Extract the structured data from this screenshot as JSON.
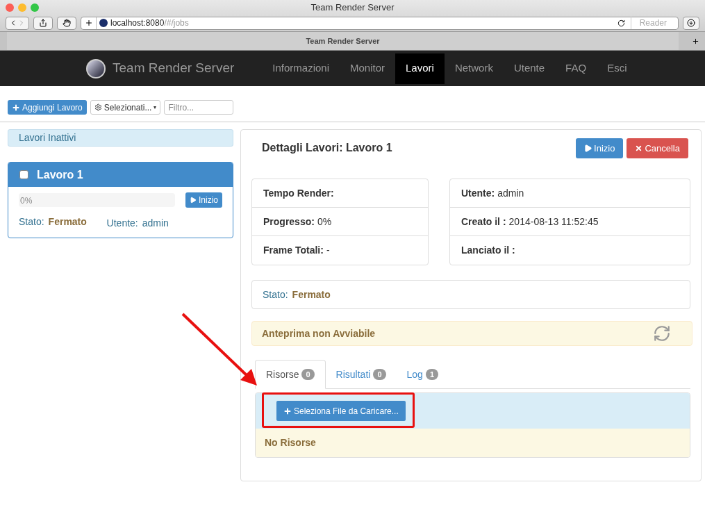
{
  "browser": {
    "title": "Team Render Server",
    "url_host": "localhost:8080",
    "url_path": "/#/jobs",
    "reader": "Reader",
    "tab_title": "Team Render Server"
  },
  "navbar": {
    "brand": "Team Render Server",
    "items": [
      {
        "label": "Informazioni",
        "selected": false
      },
      {
        "label": "Monitor",
        "selected": false
      },
      {
        "label": "Lavori",
        "selected": true
      },
      {
        "label": "Network",
        "selected": false
      },
      {
        "label": "Utente",
        "selected": false
      },
      {
        "label": "FAQ",
        "selected": false
      },
      {
        "label": "Esci",
        "selected": false
      }
    ]
  },
  "toolbar": {
    "add_button": "Aggiungi Lavoro",
    "select_button": "Selezionati...",
    "select_caret": "▾",
    "filter": {
      "placeholder": "Filtro..."
    }
  },
  "sidebar": {
    "heading": "Lavori Inattivi",
    "jobs": [
      {
        "name": "Lavoro 1",
        "checked": false,
        "level": 0,
        "progress_label": "0%",
        "start_button": "Inizio",
        "status_label": "Stato:",
        "status": "Fermato",
        "user_label": "Utente:",
        "user": "admin"
      }
    ]
  },
  "details": {
    "title": "Dettagli Lavori: Lavoro 1",
    "buttons": [
      {
        "kind": "start",
        "label": "Inizio"
      },
      {
        "kind": "cancel",
        "label": "Cancella"
      }
    ],
    "left_rows": [
      {
        "label": "Tempo Render:"
      },
      {
        "label": "Progresso:",
        "value": "0%"
      },
      {
        "label": "Frame Totali:",
        "value": "-"
      }
    ],
    "right_rows": [
      {
        "label": "Utente:",
        "value": "admin"
      },
      {
        "label": "Creato il :",
        "value": "2014-08-13 11:52:45"
      },
      {
        "label": "Lanciato il :"
      }
    ],
    "status": {
      "label": "Stato:",
      "value": "Fermato"
    },
    "preview": "Anteprima non Avviabile",
    "tabs": [
      {
        "label": "Risorse",
        "count": "0",
        "selected": true
      },
      {
        "label": "Risultati",
        "count": "0",
        "selected": false
      },
      {
        "label": "Log",
        "count": "1",
        "selected": false
      }
    ],
    "upload_button": "Seleziona File da Caricare...",
    "empty_message": "No Risorse"
  },
  "annotations": {
    "arrow": true,
    "highlight": true
  }
}
